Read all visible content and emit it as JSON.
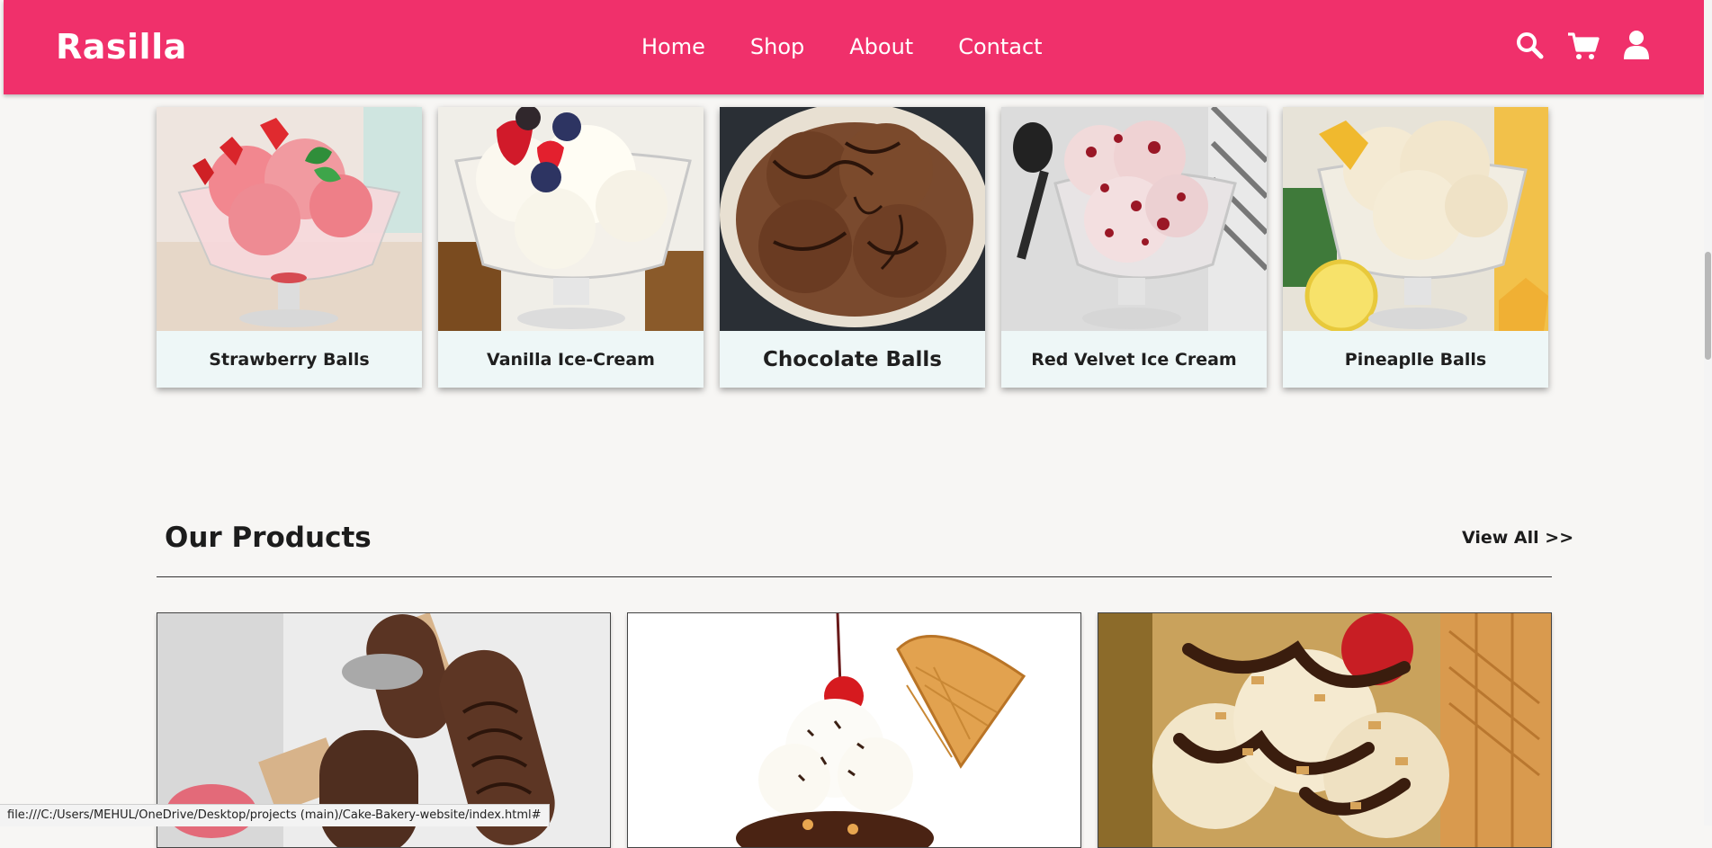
{
  "header": {
    "logo": "Rasilla",
    "nav": [
      {
        "label": "Home"
      },
      {
        "label": "Shop"
      },
      {
        "label": "About"
      },
      {
        "label": "Contact"
      }
    ],
    "icons": [
      "search-icon",
      "cart-icon",
      "user-icon"
    ]
  },
  "categories": [
    {
      "label": "Strawberry Balls"
    },
    {
      "label": "Vanilla Ice-Cream"
    },
    {
      "label": "Chocolate Balls"
    },
    {
      "label": "Red Velvet Ice Cream"
    },
    {
      "label": "Pineaplle Balls"
    }
  ],
  "products_section": {
    "title": "Our Products",
    "view_all": "View All >>"
  },
  "status_bar": {
    "url": "file:///C:/Users/MEHUL/OneDrive/Desktop/projects (main)/Cake-Bakery-website/index.html#"
  },
  "colors": {
    "brand": "#f0306b",
    "card_label_bg": "#eef7f7",
    "page_bg": "#f7f6f4"
  }
}
